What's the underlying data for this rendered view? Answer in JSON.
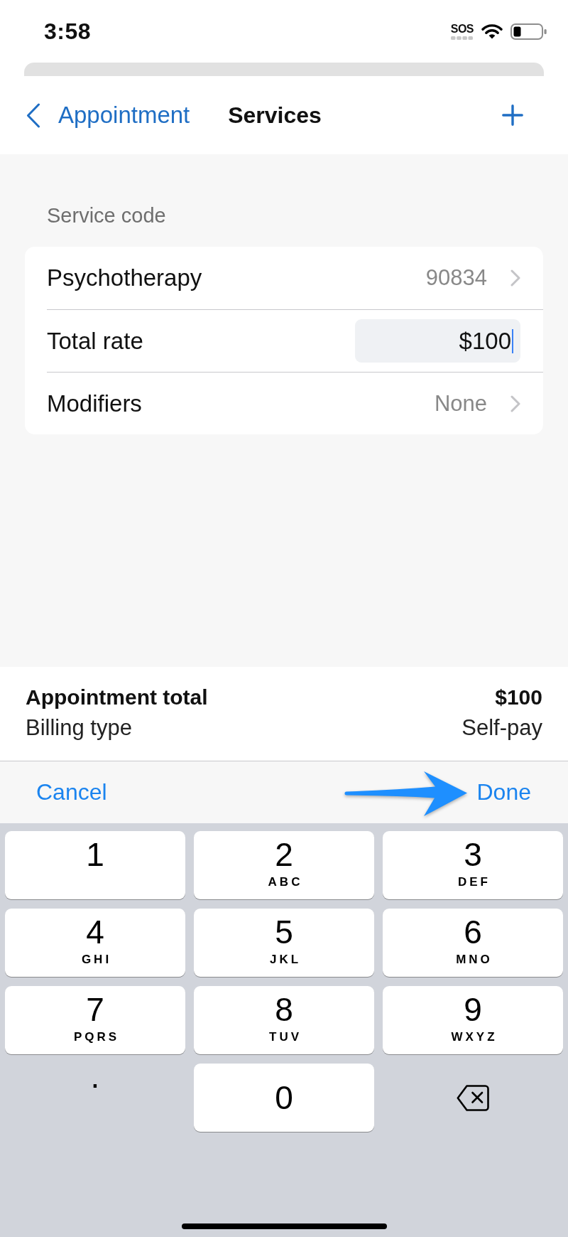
{
  "status_bar": {
    "time": "3:58",
    "signal_text": "SOS"
  },
  "nav": {
    "back": "Appointment",
    "title": "Services"
  },
  "service_section": {
    "header": "Service code",
    "rows": [
      {
        "kind": "link",
        "label": "Psychotherapy",
        "value": "90834"
      },
      {
        "kind": "input",
        "label": "Total rate",
        "value": "$100",
        "focused": true
      },
      {
        "kind": "link",
        "label": "Modifiers",
        "value": "None"
      }
    ]
  },
  "summary": [
    {
      "kind": "total",
      "label": "Appointment total",
      "value": "$100"
    },
    {
      "kind": "detail",
      "label": "Billing type",
      "value": "Self-pay"
    }
  ],
  "toolbar": {
    "cancel": "Cancel",
    "done": "Done"
  },
  "keypad": [
    {
      "kind": "digit",
      "label": "1"
    },
    {
      "kind": "digit",
      "label": "2",
      "letters": "ABC"
    },
    {
      "kind": "digit",
      "label": "3",
      "letters": "DEF"
    },
    {
      "kind": "digit",
      "label": "4",
      "letters": "GHI"
    },
    {
      "kind": "digit",
      "label": "5",
      "letters": "JKL"
    },
    {
      "kind": "digit",
      "label": "6",
      "letters": "MNO"
    },
    {
      "kind": "digit",
      "label": "7",
      "letters": "PQRS"
    },
    {
      "kind": "digit",
      "label": "8",
      "letters": "TUV"
    },
    {
      "kind": "digit",
      "label": "9",
      "letters": "WXYZ"
    },
    {
      "kind": "symbol",
      "label": "."
    },
    {
      "kind": "digit",
      "label": "0"
    },
    {
      "kind": "delete"
    }
  ]
}
